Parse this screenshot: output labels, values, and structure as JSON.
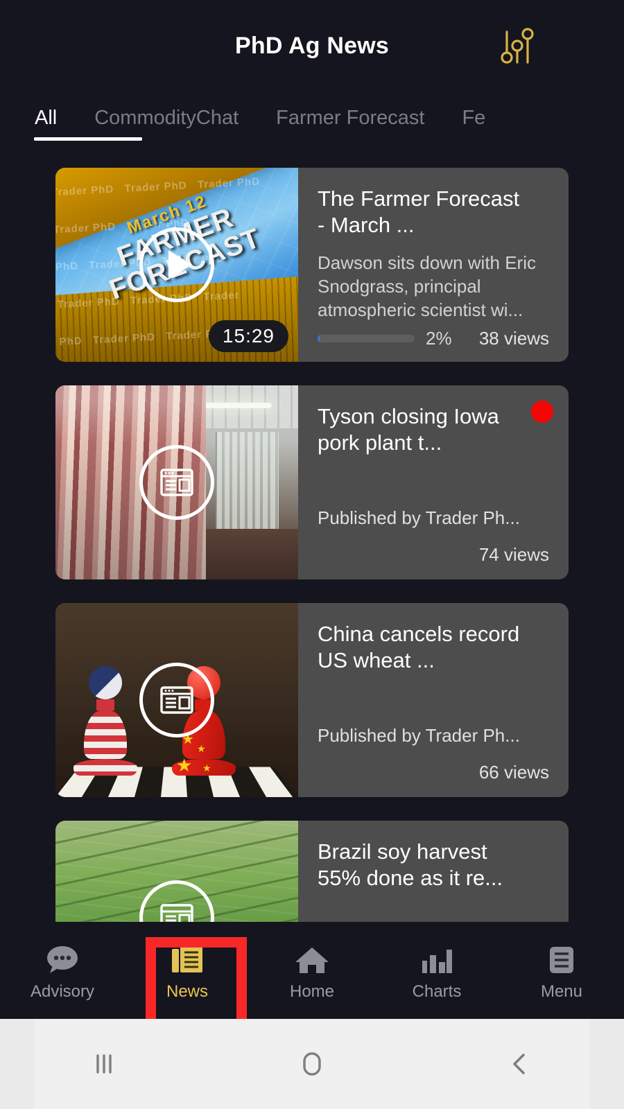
{
  "header": {
    "title": "PhD Ag News",
    "filter_icon": "sliders-filter-icon"
  },
  "tabs": [
    {
      "label": "All",
      "active": true
    },
    {
      "label": "CommodityChat",
      "active": false
    },
    {
      "label": "Farmer Forecast",
      "active": false
    },
    {
      "label": "Fe",
      "active": false
    }
  ],
  "cards": [
    {
      "type": "video",
      "title": "The Farmer Forecast - March ...",
      "description": "Dawson sits down with Eric Snodgrass, principal atmospheric scientist wi...",
      "duration": "15:29",
      "progress_pct": "2%",
      "progress_value": 2,
      "views": "38 views",
      "thumb_date": "March 12",
      "thumb_line1": "FARMER",
      "thumb_line2": "FORECAST",
      "watermark": "Trader PhD",
      "badge": false
    },
    {
      "type": "article",
      "title": "Tyson closing Iowa pork plant t...",
      "published": "Published by Trader Ph...",
      "views": "74 views",
      "badge": true
    },
    {
      "type": "article",
      "title": "China cancels record US wheat ...",
      "published": "Published by Trader Ph...",
      "views": "66 views",
      "badge": false
    },
    {
      "type": "article",
      "title": "Brazil soy harvest 55% done as it re...",
      "published": "",
      "views": "",
      "badge": false
    }
  ],
  "bottom_nav": [
    {
      "label": "Advisory",
      "icon": "chat-bubble-icon",
      "active": false
    },
    {
      "label": "News",
      "icon": "newspaper-icon",
      "active": true
    },
    {
      "label": "Home",
      "icon": "home-icon",
      "active": false
    },
    {
      "label": "Charts",
      "icon": "bar-chart-icon",
      "active": false
    },
    {
      "label": "Menu",
      "icon": "hamburger-menu-icon",
      "active": false
    }
  ],
  "system_nav": {
    "recents": "recents-icon",
    "home": "home-pill-icon",
    "back": "back-chevron-icon"
  },
  "colors": {
    "accent_gold": "#e8c44f",
    "background": "#15151f",
    "card": "#4d4d4d",
    "badge_red": "#f50505",
    "highlight_red": "#f92828",
    "progress_blue": "#3a7bd5"
  }
}
